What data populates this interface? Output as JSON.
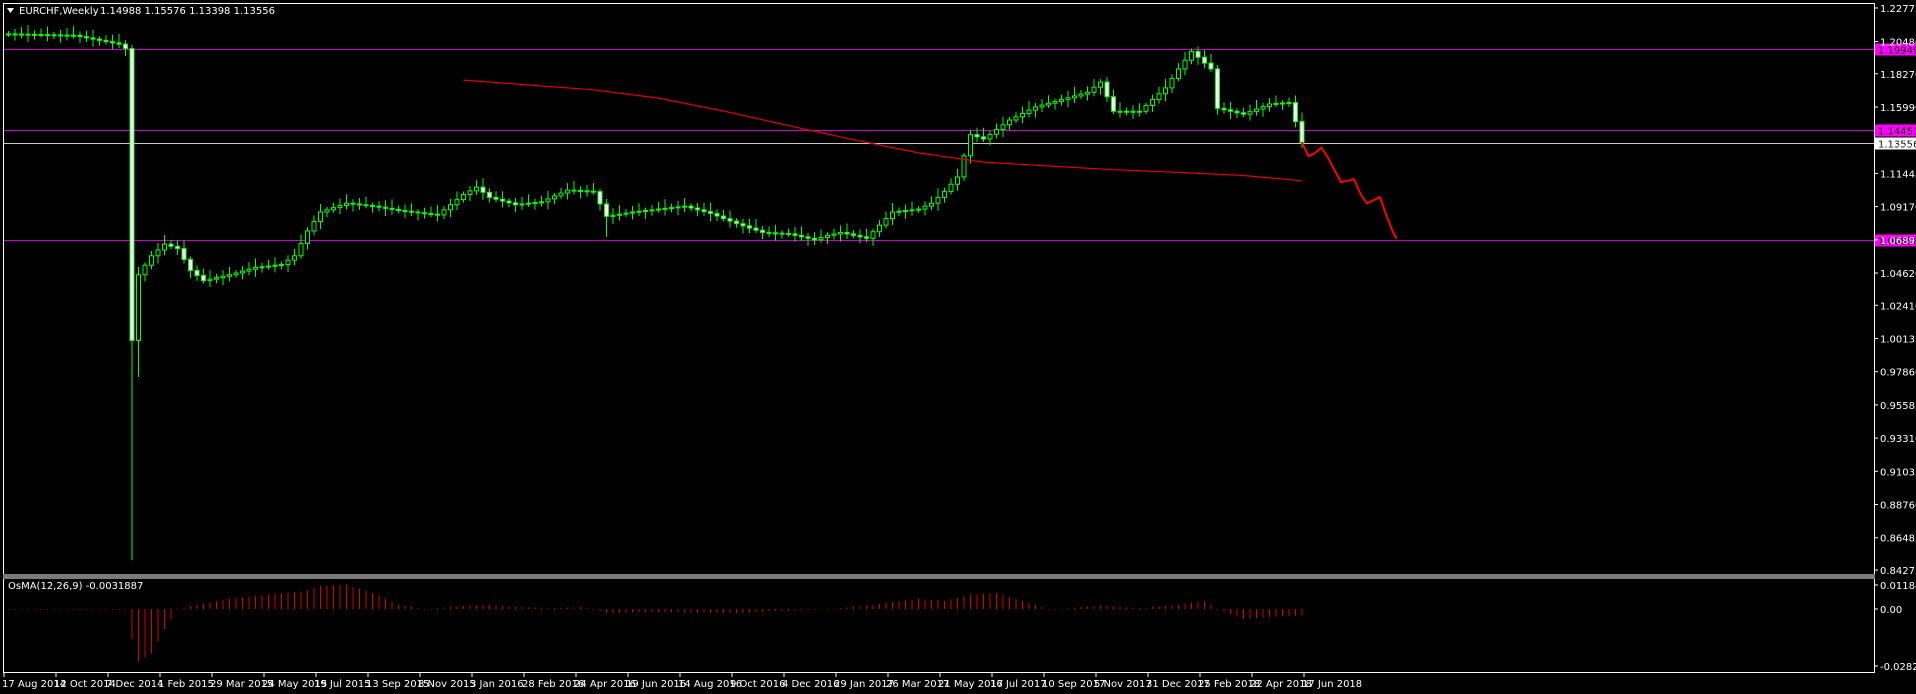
{
  "header": {
    "symbol": "EURCHF,Weekly",
    "ohlc": "1.14988 1.15576 1.13398 1.13556"
  },
  "indicator": {
    "label": "OsMA(12,26,9) -0.0031887",
    "axis_ticks": [
      "0.011845",
      "0.00",
      "-0.028201"
    ]
  },
  "colors": {
    "background": "#000000",
    "bull": "#00ff00",
    "bear_body": "#ffffff",
    "level_line": "#cc00cc",
    "level_tag": "#ff00ff",
    "ma_line": "#e00000",
    "projection": "#ff0000",
    "osma": "#e00000"
  },
  "chart_data": {
    "type": "candlestick",
    "title": "EURCHF,Weekly",
    "ylim": [
      0.84275,
      1.22775
    ],
    "y_ticks": [
      "1.22775",
      "1.20480",
      "1.18270",
      "1.15990",
      "1.13555",
      "1.11445",
      "1.09170",
      "1.06895",
      "1.04620",
      "1.02410",
      "1.00135",
      "0.97860",
      "0.95585",
      "0.93310",
      "0.91035",
      "0.88760",
      "0.86485",
      "0.84275"
    ],
    "x_ticks": [
      "17 Aug 2014",
      "12 Oct 2014",
      "7 Dec 2014",
      "1 Feb 2015",
      "29 Mar 2015",
      "24 May 2015",
      "19 Jul 2015",
      "13 Sep 2015",
      "8 Nov 2015",
      "3 Jan 2016",
      "28 Feb 2016",
      "24 Apr 2016",
      "19 Jun 2016",
      "14 Aug 2016",
      "9 Oct 2016",
      "4 Dec 2016",
      "29 Jan 2017",
      "26 Mar 2017",
      "21 May 2017",
      "16 Jul 2017",
      "10 Sep 2017",
      "5 Nov 2017",
      "31 Dec 2017",
      "25 Feb 2018",
      "22 Apr 2018",
      "17 Jun 2018"
    ],
    "levels": [
      {
        "label": "1.19949",
        "value": 1.19949
      },
      {
        "label": "1.14451",
        "value": 1.14451
      },
      {
        "label": "1.06858",
        "value": 1.06858
      }
    ],
    "current_price": {
      "label": "1.13556",
      "value": 1.13556
    },
    "series": [
      {
        "name": "price",
        "type": "candlestick",
        "close_anchors": [
          [
            0,
            1.21
          ],
          [
            10,
            1.209
          ],
          [
            17,
            1.203
          ],
          [
            18,
            1.2
          ],
          [
            19,
            1.0
          ],
          [
            20,
            1.045
          ],
          [
            22,
            1.058
          ],
          [
            24,
            1.066
          ],
          [
            26,
            1.063
          ],
          [
            28,
            1.048
          ],
          [
            30,
            1.041
          ],
          [
            34,
            1.045
          ],
          [
            38,
            1.05
          ],
          [
            42,
            1.052
          ],
          [
            44,
            1.058
          ],
          [
            46,
            1.075
          ],
          [
            48,
            1.088
          ],
          [
            52,
            1.094
          ],
          [
            56,
            1.092
          ],
          [
            60,
            1.089
          ],
          [
            66,
            1.086
          ],
          [
            70,
            1.1
          ],
          [
            72,
            1.105
          ],
          [
            74,
            1.098
          ],
          [
            78,
            1.093
          ],
          [
            82,
            1.095
          ],
          [
            86,
            1.103
          ],
          [
            90,
            1.102
          ],
          [
            92,
            1.085
          ],
          [
            96,
            1.088
          ],
          [
            100,
            1.09
          ],
          [
            104,
            1.092
          ],
          [
            108,
            1.087
          ],
          [
            112,
            1.08
          ],
          [
            116,
            1.074
          ],
          [
            120,
            1.073
          ],
          [
            124,
            1.069
          ],
          [
            126,
            1.072
          ],
          [
            128,
            1.074
          ],
          [
            132,
            1.07
          ],
          [
            134,
            1.079
          ],
          [
            136,
            1.088
          ],
          [
            140,
            1.09
          ],
          [
            142,
            1.094
          ],
          [
            144,
            1.102
          ],
          [
            146,
            1.112
          ],
          [
            148,
            1.141
          ],
          [
            150,
            1.138
          ],
          [
            154,
            1.151
          ],
          [
            158,
            1.16
          ],
          [
            162,
            1.165
          ],
          [
            166,
            1.17
          ],
          [
            168,
            1.177
          ],
          [
            170,
            1.157
          ],
          [
            174,
            1.157
          ],
          [
            178,
            1.173
          ],
          [
            180,
            1.186
          ],
          [
            182,
            1.198
          ],
          [
            185,
            1.186
          ],
          [
            186,
            1.159
          ],
          [
            190,
            1.155
          ],
          [
            194,
            1.162
          ],
          [
            197,
            1.163
          ],
          [
            198,
            1.15
          ],
          [
            199,
            1.13556
          ]
        ]
      },
      {
        "name": "moving-average",
        "type": "line",
        "points": [
          [
            70,
            1.17837
          ],
          [
            80,
            1.175
          ],
          [
            90,
            1.1717
          ],
          [
            100,
            1.166
          ],
          [
            110,
            1.1572
          ],
          [
            120,
            1.1472
          ],
          [
            130,
            1.1375
          ],
          [
            140,
            1.1285
          ],
          [
            150,
            1.1222
          ],
          [
            160,
            1.1195
          ],
          [
            170,
            1.117
          ],
          [
            180,
            1.1151
          ],
          [
            190,
            1.113
          ],
          [
            199,
            1.10939
          ]
        ]
      },
      {
        "name": "projection",
        "type": "line",
        "points": [
          [
            199,
            1.13556
          ],
          [
            200,
            1.1262
          ],
          [
            201,
            1.1284
          ],
          [
            202,
            1.1321
          ],
          [
            203,
            1.1251
          ],
          [
            205,
            1.1085
          ],
          [
            206,
            1.10939
          ],
          [
            207,
            1.1105
          ],
          [
            208,
            1.1004
          ],
          [
            209,
            1.0939
          ],
          [
            210,
            1.0961
          ],
          [
            211,
            1.0983
          ],
          [
            212,
            1.0854
          ],
          [
            213,
            1.0742
          ],
          [
            213.5,
            1.0702
          ]
        ]
      }
    ],
    "osma": {
      "ylim": [
        -0.028201,
        0.011845
      ],
      "anchors": [
        [
          0,
          0.0
        ],
        [
          18,
          0.0
        ],
        [
          19,
          -0.015
        ],
        [
          20,
          -0.026
        ],
        [
          22,
          -0.022
        ],
        [
          24,
          -0.01
        ],
        [
          26,
          0.0
        ],
        [
          28,
          0.0015
        ],
        [
          34,
          0.005
        ],
        [
          40,
          0.007
        ],
        [
          46,
          0.009
        ],
        [
          48,
          0.0115
        ],
        [
          52,
          0.012
        ],
        [
          56,
          0.008
        ],
        [
          60,
          0.002
        ],
        [
          64,
          0.0
        ],
        [
          70,
          0.0015
        ],
        [
          74,
          0.002
        ],
        [
          78,
          0.001
        ],
        [
          84,
          0.0005
        ],
        [
          88,
          0.001
        ],
        [
          90,
          0.0
        ],
        [
          92,
          -0.002
        ],
        [
          100,
          -0.0015
        ],
        [
          112,
          -0.002
        ],
        [
          122,
          -0.0005
        ],
        [
          128,
          0.0005
        ],
        [
          132,
          0.0015
        ],
        [
          136,
          0.0035
        ],
        [
          140,
          0.005
        ],
        [
          144,
          0.004
        ],
        [
          148,
          0.007
        ],
        [
          152,
          0.008
        ],
        [
          156,
          0.004
        ],
        [
          160,
          0.0
        ],
        [
          168,
          0.0015
        ],
        [
          174,
          0.0005
        ],
        [
          180,
          0.002
        ],
        [
          184,
          0.004
        ],
        [
          186,
          0.0
        ],
        [
          190,
          -0.005
        ],
        [
          194,
          -0.004
        ],
        [
          199,
          -0.0031887
        ]
      ]
    }
  }
}
